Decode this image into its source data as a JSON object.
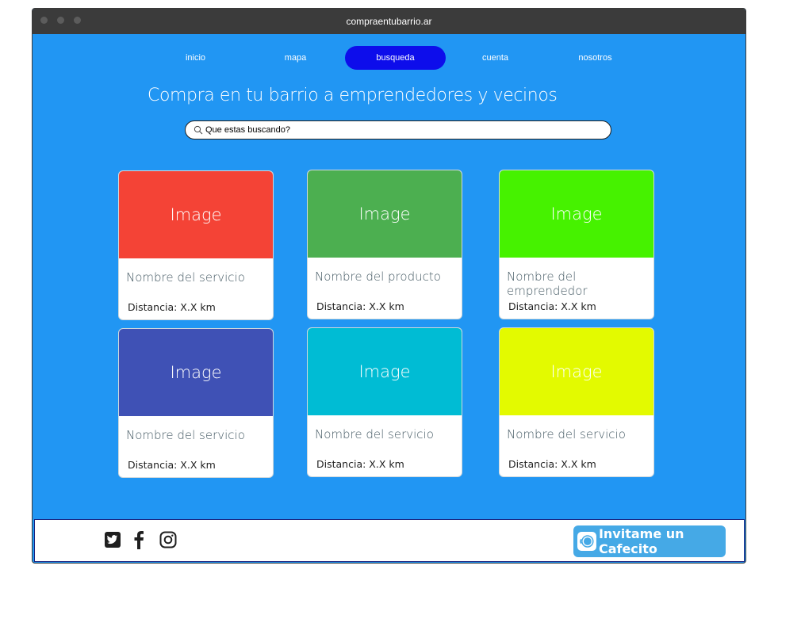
{
  "window": {
    "title": "compraentubarrio.ar"
  },
  "nav": {
    "items": [
      {
        "label": "inicio",
        "active": false
      },
      {
        "label": "mapa",
        "active": false
      },
      {
        "label": "busqueda",
        "active": true
      },
      {
        "label": "cuenta",
        "active": false
      },
      {
        "label": "nosotros",
        "active": false
      }
    ]
  },
  "headline": "Compra en tu barrio a emprendedores y vecinos",
  "search": {
    "placeholder": "Que estas buscando?",
    "value": ""
  },
  "cards": [
    {
      "image_label": "Image",
      "image_color": "#F44336",
      "name": "Nombre del servicio",
      "distance": "Distancia: X.X km"
    },
    {
      "image_label": "Image",
      "image_color": "#4CAF50",
      "name": "Nombre del producto",
      "distance": "Distancia: X.X km"
    },
    {
      "image_label": "Image",
      "image_color": "#46F200",
      "name": "Nombre del emprendedor",
      "distance": "Distancia: X.X km"
    },
    {
      "image_label": "Image",
      "image_color": "#3F51B5",
      "name": "Nombre del servicio",
      "distance": "Distancia: X.X km"
    },
    {
      "image_label": "Image",
      "image_color": "#00BCD4",
      "name": "Nombre del servicio",
      "distance": "Distancia: X.X km"
    },
    {
      "image_label": "Image",
      "image_color": "#E3FA00",
      "name": "Nombre del servicio",
      "distance": "Distancia: X.X km"
    }
  ],
  "footer": {
    "social_icons": [
      "twitter-icon",
      "facebook-icon",
      "instagram-icon"
    ],
    "cafecito_label": "Invitame un Cafecito"
  },
  "colors": {
    "background": "#2196F3",
    "nav_active": "#0D0DEB",
    "titlebar": "#3B3B3B",
    "cafecito": "#45A9E6"
  }
}
